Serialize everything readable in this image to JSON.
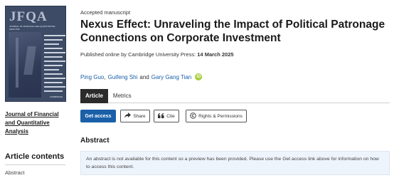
{
  "sidebar": {
    "cover": {
      "masthead": "JFQA",
      "subtitle": "Journal of Financial and Quantitative Analysis",
      "publisher": "CAMBRIDGE"
    },
    "journal_name": "Journal of Financial and Quantitative Analysis",
    "contents_title": "Article contents",
    "contents_items": [
      "Abstract"
    ]
  },
  "article": {
    "label": "Accepted manuscript",
    "title": "Nexus Effect: Unraveling the Impact of Political Patronage Connections on Corporate Investment",
    "published_prefix": "Published online by Cambridge University Press:",
    "published_date": "14 March 2025",
    "authors": [
      "Ping Guo",
      "Guifeng Shi",
      "Gary Gang Tian"
    ],
    "author_sep_1": ",",
    "author_sep_2": "and",
    "orcid_label": "iD"
  },
  "tabs": [
    "Article",
    "Metrics"
  ],
  "actions": {
    "get_access": "Get access",
    "share": "Share",
    "cite": "Cite",
    "rights": "Rights & Permissions"
  },
  "abstract": {
    "heading": "Abstract",
    "notice": "An abstract is not available for this content so a preview has been provided. Please use the Get access link above for information on how to access this content."
  },
  "colors": {
    "primary": "#1a5fa8",
    "orcid": "#a6ce39",
    "tab_active": "#2b2b2b",
    "notice_bg": "#eef4fb"
  }
}
